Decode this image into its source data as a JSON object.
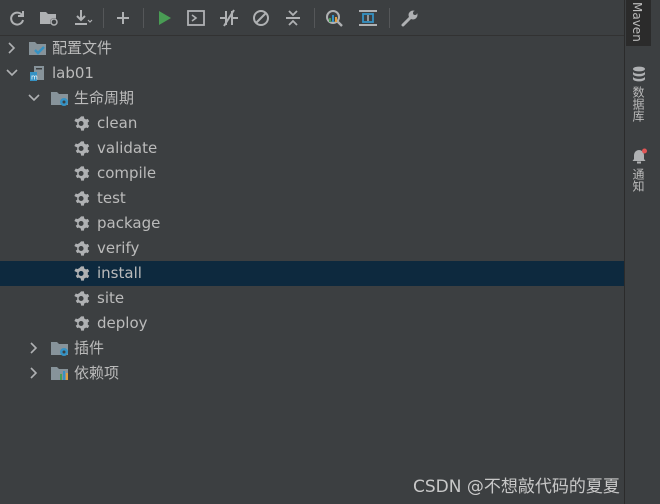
{
  "toolbar": {
    "buttons": [
      {
        "name": "reload-icon"
      },
      {
        "name": "add-maven-project-icon"
      },
      {
        "name": "download-icon"
      },
      {
        "name": "add-icon"
      },
      {
        "name": "run-icon"
      },
      {
        "name": "execute-goal-icon"
      },
      {
        "name": "toggle-offline-icon"
      },
      {
        "name": "skip-tests-icon"
      },
      {
        "name": "collapse-all-icon"
      },
      {
        "name": "analyze-dependencies-icon"
      },
      {
        "name": "show-diagram-icon"
      },
      {
        "name": "settings-wrench-icon"
      }
    ],
    "colors": {
      "run": "#499c54",
      "icon": "#afb1b3"
    }
  },
  "tree": {
    "profiles": "配置文件",
    "project": "lab01",
    "lifecycle": {
      "label": "生命周期",
      "goals": [
        "clean",
        "validate",
        "compile",
        "test",
        "package",
        "verify",
        "install",
        "site",
        "deploy"
      ],
      "selected": "install"
    },
    "plugins": "插件",
    "dependencies": "依赖项"
  },
  "sidebar": {
    "maven": "Maven",
    "database": "数据库",
    "notifications": "通知",
    "notification_badge_color": "#e05555"
  },
  "watermark": "CSDN @不想敲代码的夏夏"
}
